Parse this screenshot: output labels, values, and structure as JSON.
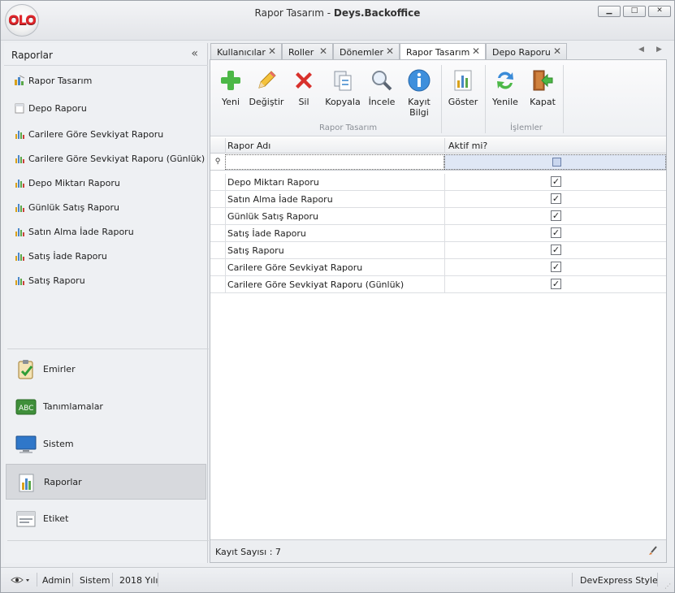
{
  "window": {
    "title_prefix": "Rapor Tasarım - ",
    "title_app": "Deys.Backoffice",
    "logo_text": "OLO",
    "minimize": "▁",
    "maximize": "□",
    "close": "✕"
  },
  "nav": {
    "header": "Raporlar",
    "collapse_icon": "«",
    "items": [
      {
        "label": "Rapor Tasarım",
        "icon": "report-design-icon"
      },
      {
        "label": "Depo Raporu",
        "icon": "document-icon"
      },
      {
        "label": "Carilere Göre Sevkiyat Raporu",
        "icon": "bar-chart-icon"
      },
      {
        "label": "Carilere Göre Sevkiyat Raporu (Günlük)",
        "icon": "bar-chart-icon"
      },
      {
        "label": "Depo Miktarı Raporu",
        "icon": "bar-chart-icon"
      },
      {
        "label": "Günlük Satış Raporu",
        "icon": "bar-chart-icon"
      },
      {
        "label": "Satın Alma İade Raporu",
        "icon": "bar-chart-icon"
      },
      {
        "label": "Satış İade Raporu",
        "icon": "bar-chart-icon"
      },
      {
        "label": "Satış Raporu",
        "icon": "bar-chart-icon"
      }
    ],
    "groups": [
      {
        "label": "Emirler",
        "icon": "clipboard-check-icon"
      },
      {
        "label": "Tanımlamalar",
        "icon": "abc-icon"
      },
      {
        "label": "Sistem",
        "icon": "monitor-icon"
      },
      {
        "label": "Raporlar",
        "icon": "bar-chart-icon",
        "selected": true
      },
      {
        "label": "Etiket",
        "icon": "label-icon"
      }
    ]
  },
  "tabs": [
    {
      "label": "Kullanıcılar",
      "close": "✕"
    },
    {
      "label": "Roller",
      "close": "✕"
    },
    {
      "label": "Dönemler",
      "close": "✕"
    },
    {
      "label": "Rapor Tasarım",
      "close": "✕",
      "active": true
    },
    {
      "label": "Depo Raporu",
      "close": "✕"
    }
  ],
  "tab_nav": {
    "prev": "◀",
    "next": "▶"
  },
  "ribbon": {
    "buttons": [
      {
        "label": "Yeni",
        "icon": "plus-icon"
      },
      {
        "label": "Değiştir",
        "icon": "pencil-icon"
      },
      {
        "label": "Sil",
        "icon": "delete-x-icon"
      },
      {
        "label": "Kopyala",
        "icon": "copy-icon"
      },
      {
        "label": "İncele",
        "icon": "magnifier-icon"
      },
      {
        "label": "Kayıt\nBilgi",
        "icon": "info-icon"
      },
      {
        "label": "Göster",
        "icon": "chart-icon"
      },
      {
        "label": "Yenile",
        "icon": "refresh-icon"
      },
      {
        "label": "Kapat",
        "icon": "exit-door-icon"
      }
    ],
    "group_labels": [
      "Rapor Tasarım",
      "İşlemler"
    ]
  },
  "grid": {
    "columns": [
      "Rapor Adı",
      "Aktif mi?"
    ],
    "filter_icon": "⚲",
    "rows": [
      {
        "name": "Depo Miktarı Raporu",
        "active": "✓"
      },
      {
        "name": "Satın Alma İade Raporu",
        "active": "✓"
      },
      {
        "name": "Günlük Satış Raporu",
        "active": "✓"
      },
      {
        "name": "Satış İade Raporu",
        "active": "✓"
      },
      {
        "name": "Satış Raporu",
        "active": "✓"
      },
      {
        "name": "Carilere Göre Sevkiyat Raporu",
        "active": "✓"
      },
      {
        "name": "Carilere Göre Sevkiyat Raporu (Günlük)",
        "active": "✓"
      }
    ],
    "footer_count": "Kayıt Sayısı : 7"
  },
  "status": {
    "user_menu_icon": "eye-icon",
    "user": "Admin",
    "module": "Sistem",
    "year": "2018 Yılı",
    "style": "DevExpress Style"
  }
}
